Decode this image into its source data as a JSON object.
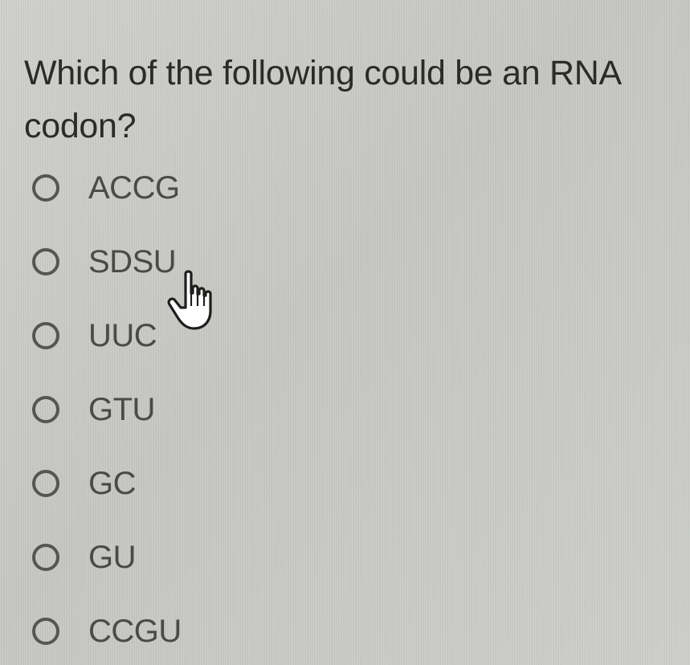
{
  "question": {
    "text": "Which of the following could be an RNA codon?"
  },
  "options": [
    {
      "label": "ACCG",
      "selected": false
    },
    {
      "label": "SDSU",
      "selected": false
    },
    {
      "label": "UUC",
      "selected": false
    },
    {
      "label": "GTU",
      "selected": false
    },
    {
      "label": "GC",
      "selected": false
    },
    {
      "label": "GU",
      "selected": false
    },
    {
      "label": "CCGU",
      "selected": false
    }
  ],
  "cursor": {
    "icon": "hand-pointer-icon"
  }
}
